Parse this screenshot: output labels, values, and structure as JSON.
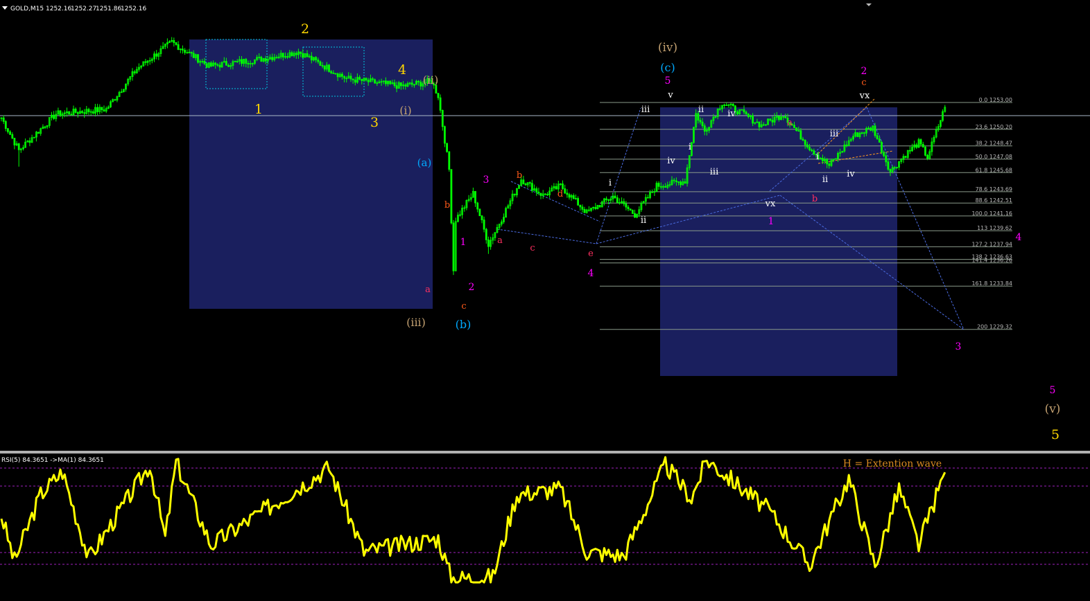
{
  "header": {
    "symbol": "GOLD,M15",
    "open": "1252.16",
    "high": "1252.27",
    "low": "1251.86",
    "close": "1252.16"
  },
  "rsi_header": "RSI(5) 84.3651  ->MA(1) 84.3651",
  "note": "H = Extention wave",
  "colors": {
    "background": "#000000",
    "candle": "#00ff00",
    "rsi_line": "#ffff00",
    "box": "#1a1f5e",
    "fib_line": "#8a9a8a",
    "fib_text": "#b8b8b8",
    "trend_line": "#4a6be0"
  },
  "fib_levels": [
    {
      "label": "0.0 1253.00",
      "price": 1253.0
    },
    {
      "label": "23.6 1250.20",
      "price": 1250.2
    },
    {
      "label": "38.2 1248.47",
      "price": 1248.47
    },
    {
      "label": "50.0 1247.08",
      "price": 1247.08
    },
    {
      "label": "61.8 1245.68",
      "price": 1245.68
    },
    {
      "label": "78.6 1243.69",
      "price": 1243.69
    },
    {
      "label": "88.6 1242.51",
      "price": 1242.51
    },
    {
      "label": "100.0 1241.16",
      "price": 1241.16
    },
    {
      "label": "113 1239.62",
      "price": 1239.62
    },
    {
      "label": "127.2 1237.94",
      "price": 1237.94
    },
    {
      "label": "138.2 1236.63",
      "price": 1236.63
    },
    {
      "label": "141.4 1236.26",
      "price": 1236.26
    },
    {
      "label": "161.8 1233.84",
      "price": 1233.84
    },
    {
      "label": "200 1229.32",
      "price": 1229.32
    }
  ],
  "wave_labels": [
    {
      "t": "2",
      "c": "#ffd700",
      "s": 19
    },
    {
      "t": "1",
      "c": "#ffd700",
      "s": 19
    },
    {
      "t": "4",
      "c": "#ffd700",
      "s": 19
    },
    {
      "t": "3",
      "c": "#ffd700",
      "s": 19
    },
    {
      "t": "(ii)",
      "c": "#c2a070",
      "s": 16
    },
    {
      "t": "(i)",
      "c": "#c2a070",
      "s": 16
    },
    {
      "t": "(a)",
      "c": "#00aaff",
      "s": 15
    },
    {
      "t": "b",
      "c": "#ff5a1a",
      "s": 13
    },
    {
      "t": "a",
      "c": "#ff3060",
      "s": 13
    },
    {
      "t": "1",
      "c": "#ff00ff",
      "s": 14
    },
    {
      "t": "2",
      "c": "#ff00ff",
      "s": 14
    },
    {
      "t": "c",
      "c": "#ff5a1a",
      "s": 13
    },
    {
      "t": "(iii)",
      "c": "#c2a070",
      "s": 16
    },
    {
      "t": "(b)",
      "c": "#00aaff",
      "s": 16
    },
    {
      "t": "3",
      "c": "#ff00ff",
      "s": 14
    },
    {
      "t": "b",
      "c": "#ff5a1a",
      "s": 13
    },
    {
      "t": "d",
      "c": "#ff5a1a",
      "s": 13
    },
    {
      "t": "a",
      "c": "#ff3060",
      "s": 13
    },
    {
      "t": "c",
      "c": "#ff3060",
      "s": 13
    },
    {
      "t": "e",
      "c": "#ff3060",
      "s": 13
    },
    {
      "t": "4",
      "c": "#ff00ff",
      "s": 14
    },
    {
      "t": "(iv)",
      "c": "#c2a070",
      "s": 17
    },
    {
      "t": "(c)",
      "c": "#00aaff",
      "s": 16
    },
    {
      "t": "5",
      "c": "#ff00ff",
      "s": 14
    },
    {
      "t": "v",
      "c": "#ffffff",
      "s": 13
    },
    {
      "t": "iii",
      "c": "#ffffff",
      "s": 13
    },
    {
      "t": "ii",
      "c": "#ffffff",
      "s": 13
    },
    {
      "t": "iv",
      "c": "#ffffff",
      "s": 13
    },
    {
      "t": "i",
      "c": "#ffffff",
      "s": 13
    },
    {
      "t": "iv",
      "c": "#ffffff",
      "s": 13
    },
    {
      "t": "i",
      "c": "#ffffff",
      "s": 13
    },
    {
      "t": "ii",
      "c": "#ffffff",
      "s": 13
    },
    {
      "t": "iii",
      "c": "#ffffff",
      "s": 13
    },
    {
      "t": "a",
      "c": "#ff3060",
      "s": 13
    },
    {
      "t": "vx",
      "c": "#ffffff",
      "s": 13
    },
    {
      "t": "1",
      "c": "#ff00ff",
      "s": 14
    },
    {
      "t": "b",
      "c": "#ff3060",
      "s": 13
    },
    {
      "t": "i",
      "c": "#ffffff",
      "s": 13
    },
    {
      "t": "iii",
      "c": "#ffffff",
      "s": 13
    },
    {
      "t": "ii",
      "c": "#ffffff",
      "s": 13
    },
    {
      "t": "iv",
      "c": "#ffffff",
      "s": 13
    },
    {
      "t": "2",
      "c": "#ff00ff",
      "s": 14
    },
    {
      "t": "c",
      "c": "#ff5a1a",
      "s": 13
    },
    {
      "t": "vx",
      "c": "#ffffff",
      "s": 13
    },
    {
      "t": "4",
      "c": "#ff00ff",
      "s": 14
    },
    {
      "t": "3",
      "c": "#ff00ff",
      "s": 14
    },
    {
      "t": "5",
      "c": "#ff00ff",
      "s": 14
    },
    {
      "t": "(v)",
      "c": "#c2a070",
      "s": 17
    },
    {
      "t": "5",
      "c": "#ffd700",
      "s": 19
    }
  ],
  "chart_data": [
    {
      "type": "candlestick",
      "title": "GOLD,M15",
      "x": "bar index (15-minute bars)",
      "y_unit": "price",
      "ylim": [
        1228.0,
        1263.0
      ],
      "note": "Approximate close path through key swing points (read from chart).",
      "swing_points": [
        {
          "bar": 0,
          "price": 1251.4
        },
        {
          "bar": 8,
          "price": 1248.0
        },
        {
          "bar": 25,
          "price": 1251.8
        },
        {
          "bar": 48,
          "price": 1252.3
        },
        {
          "bar": 62,
          "price": 1256.5
        },
        {
          "bar": 78,
          "price": 1259.3
        },
        {
          "bar": 95,
          "price": 1256.8
        },
        {
          "bar": 118,
          "price": 1257.5
        },
        {
          "bar": 136,
          "price": 1258.3
        },
        {
          "bar": 158,
          "price": 1255.5
        },
        {
          "bar": 183,
          "price": 1254.7
        },
        {
          "bar": 197,
          "price": 1255.2
        },
        {
          "bar": 200,
          "price": 1253.7
        },
        {
          "bar": 205,
          "price": 1246.0
        },
        {
          "bar": 207,
          "price": 1235.5
        },
        {
          "bar": 208,
          "price": 1240.8
        },
        {
          "bar": 216,
          "price": 1243.5
        },
        {
          "bar": 223,
          "price": 1238.2
        },
        {
          "bar": 226,
          "price": 1239.5
        },
        {
          "bar": 238,
          "price": 1245.0
        },
        {
          "bar": 248,
          "price": 1243.3
        },
        {
          "bar": 256,
          "price": 1244.3
        },
        {
          "bar": 268,
          "price": 1241.5
        },
        {
          "bar": 280,
          "price": 1243.2
        },
        {
          "bar": 290,
          "price": 1241.3
        },
        {
          "bar": 300,
          "price": 1244.3
        },
        {
          "bar": 313,
          "price": 1244.8
        },
        {
          "bar": 318,
          "price": 1251.8
        },
        {
          "bar": 322,
          "price": 1250.0
        },
        {
          "bar": 330,
          "price": 1253.0
        },
        {
          "bar": 339,
          "price": 1251.9
        },
        {
          "bar": 348,
          "price": 1250.6
        },
        {
          "bar": 358,
          "price": 1251.8
        },
        {
          "bar": 370,
          "price": 1248.3
        },
        {
          "bar": 379,
          "price": 1246.4
        },
        {
          "bar": 390,
          "price": 1249.5
        },
        {
          "bar": 399,
          "price": 1250.4
        },
        {
          "bar": 407,
          "price": 1245.8
        },
        {
          "bar": 414,
          "price": 1247.6
        },
        {
          "bar": 420,
          "price": 1248.8
        },
        {
          "bar": 424,
          "price": 1247.3
        },
        {
          "bar": 432,
          "price": 1252.5
        }
      ]
    },
    {
      "type": "line",
      "title": "RSI(5) 84.3651  ->MA(1) 84.3651",
      "y_unit": "RSI",
      "ylim": [
        0,
        100
      ],
      "last_value": 84.3651,
      "note": "Approximate RSI(5) swing values read from the indicator window.",
      "swing_points": [
        {
          "bar": 0,
          "value": 52
        },
        {
          "bar": 6,
          "value": 18
        },
        {
          "bar": 18,
          "value": 68
        },
        {
          "bar": 28,
          "value": 85
        },
        {
          "bar": 40,
          "value": 20
        },
        {
          "bar": 68,
          "value": 90
        },
        {
          "bar": 75,
          "value": 35
        },
        {
          "bar": 80,
          "value": 92
        },
        {
          "bar": 96,
          "value": 30
        },
        {
          "bar": 150,
          "value": 88
        },
        {
          "bar": 166,
          "value": 25
        },
        {
          "bar": 200,
          "value": 35
        },
        {
          "bar": 206,
          "value": 5
        },
        {
          "bar": 225,
          "value": 6
        },
        {
          "bar": 236,
          "value": 68
        },
        {
          "bar": 256,
          "value": 72
        },
        {
          "bar": 268,
          "value": 25
        },
        {
          "bar": 285,
          "value": 22
        },
        {
          "bar": 304,
          "value": 90
        },
        {
          "bar": 316,
          "value": 65
        },
        {
          "bar": 323,
          "value": 94
        },
        {
          "bar": 352,
          "value": 55
        },
        {
          "bar": 370,
          "value": 15
        },
        {
          "bar": 388,
          "value": 80
        },
        {
          "bar": 400,
          "value": 15
        },
        {
          "bar": 411,
          "value": 72
        },
        {
          "bar": 420,
          "value": 30
        },
        {
          "bar": 432,
          "value": 84.4
        }
      ]
    }
  ]
}
